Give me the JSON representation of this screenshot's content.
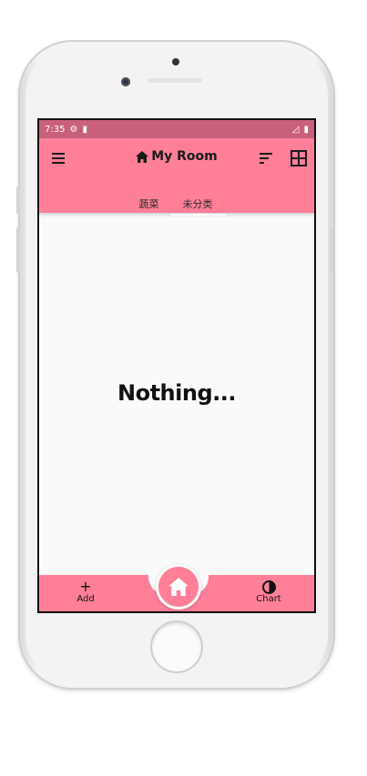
{
  "status": {
    "time": "7:35"
  },
  "appbar": {
    "title": "My Room"
  },
  "tabs": [
    {
      "label": "蔬菜"
    },
    {
      "label": "未分类"
    }
  ],
  "content": {
    "empty_text": "Nothing..."
  },
  "bottom_nav": {
    "add_label": "Add",
    "add_glyph": "+",
    "chart_label": "Chart"
  },
  "colors": {
    "accent": "#ff7f98",
    "status_bar": "#c9607a"
  },
  "icons": [
    "menu-icon",
    "home-icon",
    "sort-icon",
    "grid-view-icon",
    "add-icon",
    "chart-icon",
    "settings-icon",
    "sim-icon",
    "signal-icon",
    "battery-icon"
  ]
}
